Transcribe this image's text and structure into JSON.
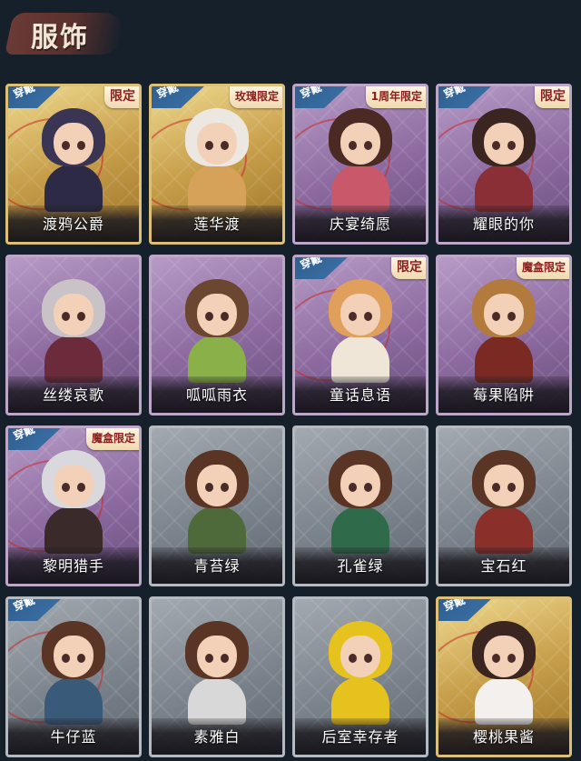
{
  "header": {
    "title": "服饰"
  },
  "wear_label": "穿戴",
  "cards": [
    {
      "name": "渡鸦公爵",
      "theme": "gold",
      "tag": "限定",
      "worn": true,
      "hair": "#3a3552",
      "body": "#2c2a44"
    },
    {
      "name": "莲华渡",
      "theme": "gold",
      "tag": "玫瑰限定",
      "worn": true,
      "hair": "#ece7e0",
      "body": "#d6a25a"
    },
    {
      "name": "庆宴绮愿",
      "theme": "purple",
      "tag": "1周年限定",
      "worn": true,
      "hair": "#4a2a22",
      "body": "#c9586b"
    },
    {
      "name": "耀眼的你",
      "theme": "purple",
      "tag": "限定",
      "worn": true,
      "hair": "#3a2520",
      "body": "#8a2f36"
    },
    {
      "name": "丝缕哀歌",
      "theme": "purple",
      "tag": "",
      "worn": false,
      "hair": "#c9c2c6",
      "body": "#6b2b3b"
    },
    {
      "name": "呱呱雨衣",
      "theme": "purple",
      "tag": "",
      "worn": false,
      "hair": "#6b4732",
      "body": "#8ab04a"
    },
    {
      "name": "童话息语",
      "theme": "purple",
      "tag": "限定",
      "worn": true,
      "hair": "#e0a05c",
      "body": "#f0e6d8"
    },
    {
      "name": "莓果陷阱",
      "theme": "purple",
      "tag": "魔盒限定",
      "worn": false,
      "hair": "#b37a3e",
      "body": "#7a2a22"
    },
    {
      "name": "黎明猎手",
      "theme": "purple",
      "tag": "魔盒限定",
      "worn": true,
      "hair": "#d9d9dd",
      "body": "#3a2a2a"
    },
    {
      "name": "青苔绿",
      "theme": "grey",
      "tag": "",
      "worn": false,
      "hair": "#5a3526",
      "body": "#4f6a3a"
    },
    {
      "name": "孔雀绿",
      "theme": "grey",
      "tag": "",
      "worn": false,
      "hair": "#5a3526",
      "body": "#2f6a4a"
    },
    {
      "name": "宝石红",
      "theme": "grey",
      "tag": "",
      "worn": false,
      "hair": "#5a3526",
      "body": "#8a2f2a"
    },
    {
      "name": "牛仔蓝",
      "theme": "grey",
      "tag": "",
      "worn": true,
      "hair": "#5a3526",
      "body": "#3a5a7a"
    },
    {
      "name": "素雅白",
      "theme": "grey",
      "tag": "",
      "worn": false,
      "hair": "#5a3526",
      "body": "#d8d8d8"
    },
    {
      "name": "后室幸存者",
      "theme": "grey",
      "tag": "",
      "worn": false,
      "hair": "#e6c21f",
      "body": "#e6c21f"
    },
    {
      "name": "樱桃果酱",
      "theme": "gold",
      "tag": "",
      "worn": true,
      "hair": "#3a2520",
      "body": "#f4f0ee"
    }
  ]
}
